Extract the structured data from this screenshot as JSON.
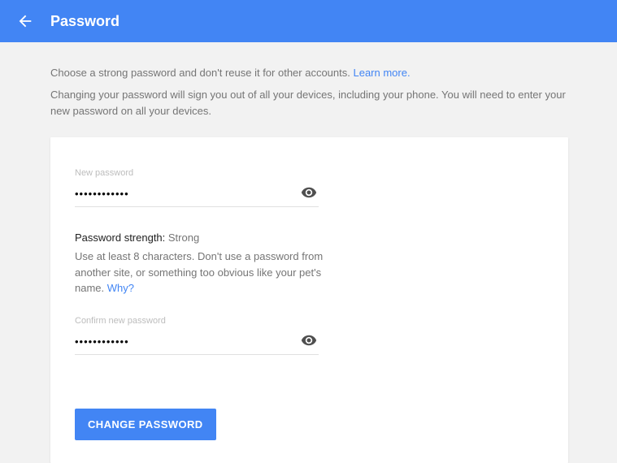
{
  "header": {
    "title": "Password"
  },
  "intro": {
    "line1_prefix": "Choose a strong password and don't reuse it for other accounts. ",
    "learn_more": "Learn more.",
    "line2": "Changing your password will sign you out of all your devices, including your phone. You will need to enter your new password on all your devices."
  },
  "form": {
    "new_password_label": "New password",
    "new_password_value": "••••••••••••",
    "strength_label": "Password strength: ",
    "strength_value": "Strong",
    "hint_text": "Use at least 8 characters. Don't use a password from another site, or something too obvious like your pet's name. ",
    "hint_link": "Why?",
    "confirm_label": "Confirm new password",
    "confirm_value": "••••••••••••",
    "submit_label": "CHANGE PASSWORD"
  }
}
